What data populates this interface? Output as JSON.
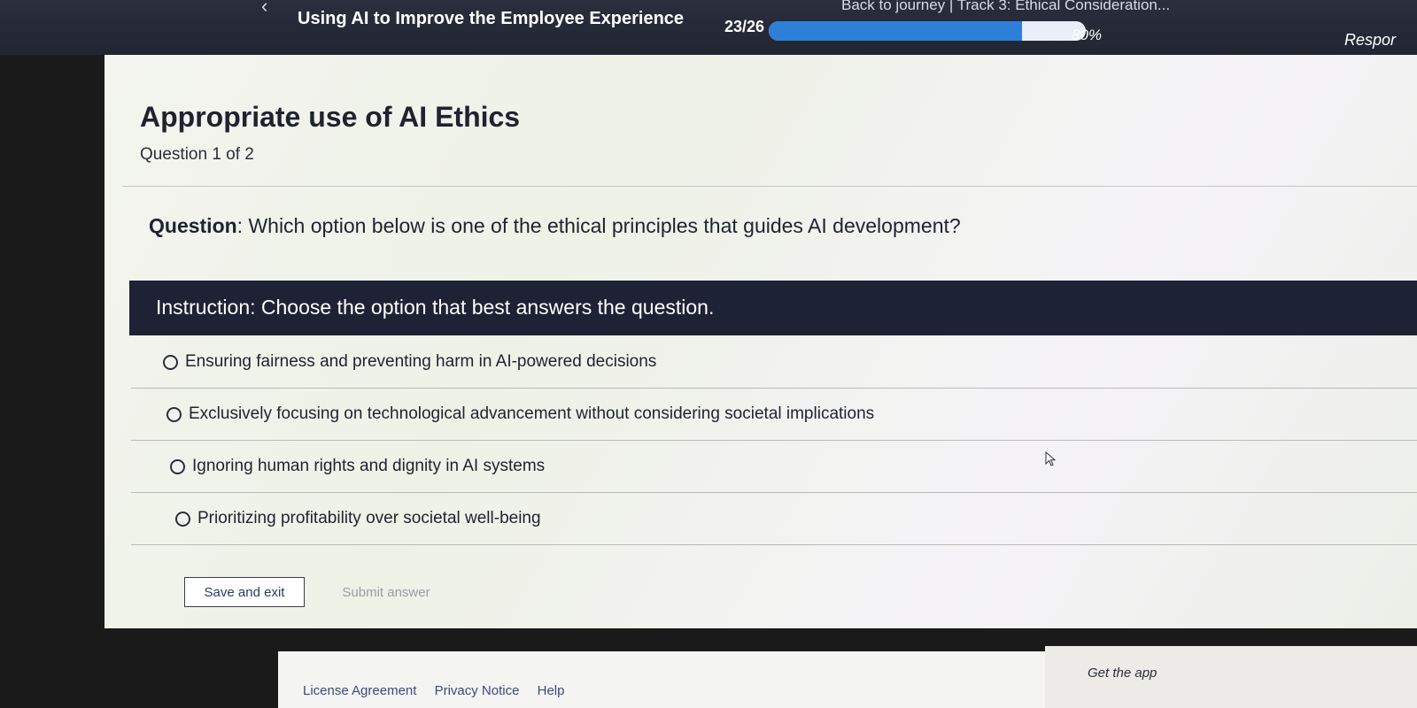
{
  "header": {
    "breadcrumb": "Back to journey | Track 3: Ethical Consideration...",
    "course_title": "Using AI to Improve the Employee Experience",
    "progress_count": "23/26",
    "progress_fraction": 0.8,
    "progress_percent": "80%",
    "respond_label": "Respor"
  },
  "quiz": {
    "heading": "Appropriate use of AI Ethics",
    "question_count": "Question 1 of 2",
    "question_label": "Question",
    "question_text": ": Which option below is one of the ethical principles that guides AI development?",
    "instruction": "Instruction: Choose the option that best answers the question.",
    "options": [
      "Ensuring fairness and preventing harm in AI-powered decisions",
      "Exclusively focusing on technological advancement without considering societal implications",
      "Ignoring human rights and dignity in AI systems",
      "Prioritizing profitability over societal well-being"
    ],
    "save_label": "Save and exit",
    "submit_label": "Submit answer"
  },
  "footer": {
    "links": [
      "License Agreement",
      "Privacy Notice",
      "Help"
    ],
    "get_app": "Get the app"
  },
  "colors": {
    "header_bg": "#222632",
    "progress_fill": "#2d7fd7",
    "instruction_bg": "#1e2235"
  },
  "icons": {
    "back": "chevron-left-icon",
    "cursor": "mouse-pointer-icon",
    "radio": "radio-empty-icon"
  }
}
